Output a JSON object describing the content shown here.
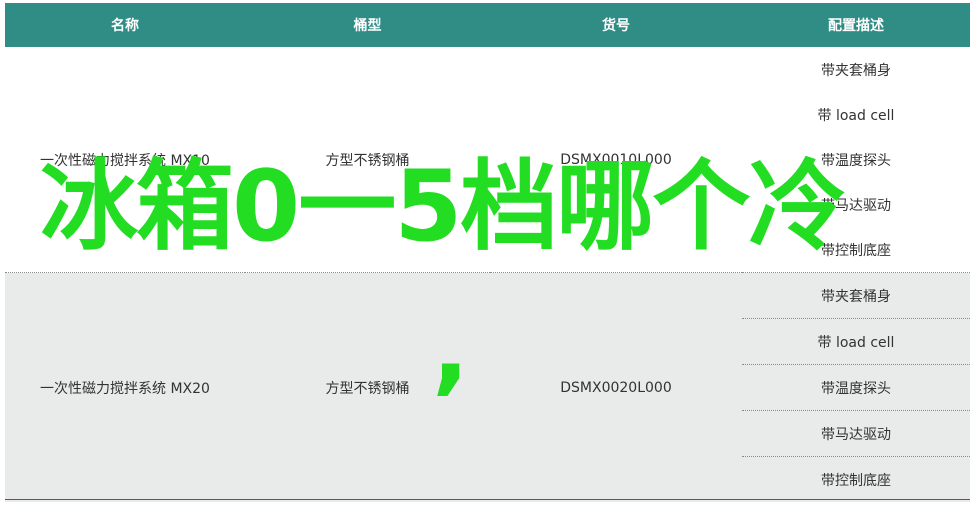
{
  "table": {
    "headers": [
      "名称",
      "桶型",
      "货号",
      "配置描述"
    ],
    "rows": [
      {
        "name": "一次性磁力搅拌系统 MX10",
        "type": "方型不锈钢桶",
        "sku": "DSMX0010L000",
        "configs": [
          "带夹套桶身",
          "带 load cell",
          "带温度探头",
          "带马达驱动",
          "带控制底座"
        ]
      },
      {
        "name": "一次性磁力搅拌系统 MX20",
        "type": "方型不锈钢桶",
        "sku": "DSMX0020L000",
        "configs": [
          "带夹套桶身",
          "带 load cell",
          "带温度探头",
          "带马达驱动",
          "带控制底座"
        ]
      }
    ]
  },
  "overlay": {
    "title": "冰箱0一5档哪个冷",
    "comma": ",",
    "color": "#22dd22"
  },
  "colors": {
    "header_bg": "#2f8d86",
    "row_alt_bg": "#e9ebea"
  }
}
